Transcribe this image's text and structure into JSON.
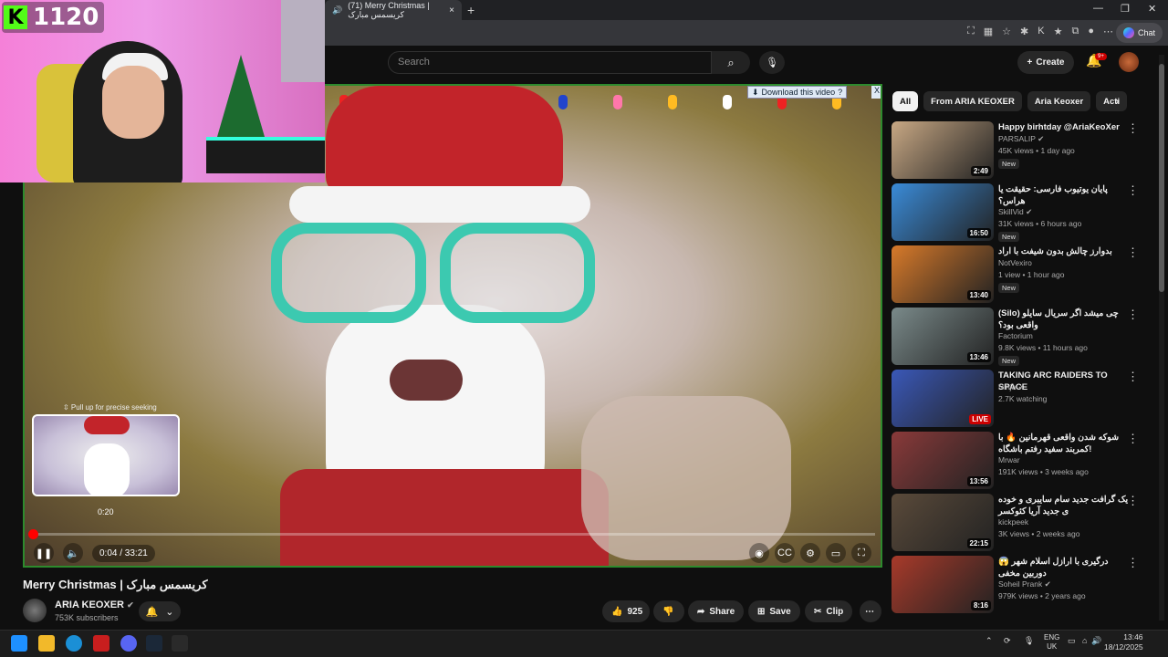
{
  "browser": {
    "tab_title": "(71) Merry Christmas | کریسمس مبارک",
    "tab_close": "×",
    "new_tab": "+",
    "chat_label": "Chat",
    "window_min": "—",
    "window_max": "❐",
    "window_close": "✕"
  },
  "overlay": {
    "kick_logo": "K",
    "kick_viewers": "1120"
  },
  "header": {
    "search_placeholder": "Search",
    "create_label": "Create",
    "notif_badge": "9+"
  },
  "player": {
    "download_label": "Download this video",
    "download_help": "?",
    "download_close": "X",
    "seek_hint": "⇳ Pull up for precise seeking",
    "preview_time": "0:20",
    "time_display": "0:04 / 33:21",
    "progress_fraction": 0.002,
    "accent_color": "#ff0000"
  },
  "video": {
    "title": "Merry Christmas | کریسمس مبارک",
    "channel": "ARIA KEOXER",
    "subscribers": "753K subscribers",
    "likes": "925",
    "share_label": "Share",
    "save_label": "Save",
    "clip_label": "Clip"
  },
  "chips": [
    "All",
    "From ARIA KEOXER",
    "Aria Keoxer",
    "Acti"
  ],
  "recommendations": [
    {
      "title": "Happy birhtday @AriaKeoXer",
      "channel": "PARSALIP",
      "verified": true,
      "meta": "45K views • 1 day ago",
      "badge": "New",
      "duration": "2:49",
      "thumb": "#c8a884"
    },
    {
      "title": "پایان یوتیوب فارسی: حقیقت یا هراس؟",
      "channel": "SkillVid",
      "verified": true,
      "meta": "31K views • 6 hours ago",
      "badge": "New",
      "duration": "16:50",
      "thumb": "#3a8bd8"
    },
    {
      "title": "بدوارز چالش بدون شیفت با اراد",
      "channel": "NotVexiro",
      "verified": false,
      "meta": "1 view • 1 hour ago",
      "badge": "New",
      "duration": "13:40",
      "thumb": "#d87a2a"
    },
    {
      "title": "(Silo) چی میشد اگر سریال سایلو واقعی بود؟",
      "channel": "Factorium",
      "verified": false,
      "meta": "9.8K views • 11 hours ago",
      "badge": "New",
      "duration": "13:46",
      "thumb": "#7a8a8a"
    },
    {
      "title": "TAKING ARC RAIDERS TO SPACE",
      "channel": "Ninja",
      "verified": true,
      "meta": "2.7K watching",
      "badge": "",
      "duration": "LIVE",
      "thumb": "#3a58b8"
    },
    {
      "title": "شوکه شدن واقعی قهرمانین 🔥 با کمربند سفید رفتم باشگاه!",
      "channel": "Mrwar",
      "verified": false,
      "meta": "191K views • 3 weeks ago",
      "badge": "",
      "duration": "13:56",
      "thumb": "#8a3a3a"
    },
    {
      "title": "یک گرافت جدید سام سایبری و خوده ی جدید آریا کئوکسر",
      "channel": "kickpeek",
      "verified": false,
      "meta": "3K views • 2 weeks ago",
      "badge": "",
      "duration": "22:15",
      "thumb": "#5a4a3a"
    },
    {
      "title": "درگیری با ارازل اسلام شهر 😱 دوربین مخفی",
      "channel": "Soheil Prank",
      "verified": true,
      "meta": "979K views • 2 years ago",
      "badge": "",
      "duration": "8:16",
      "thumb": "#a83a2a"
    }
  ],
  "taskbar": {
    "lang_top": "ENG",
    "lang_bottom": "UK",
    "time": "13:46",
    "date": "18/12/2025"
  }
}
